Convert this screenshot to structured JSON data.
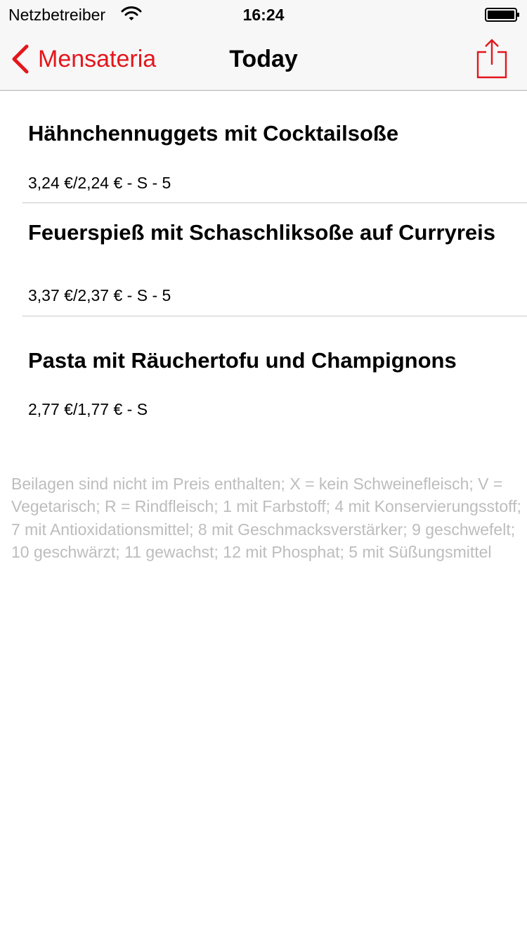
{
  "status_bar": {
    "carrier": "Netzbetreiber",
    "time": "16:24",
    "wifi_icon": "wifi-icon",
    "battery_icon": "battery-full-icon"
  },
  "nav_bar": {
    "back_label": "Mensateria",
    "back_icon": "chevron-left-icon",
    "title": "Today",
    "share_icon": "share-icon",
    "accent_color": "#e4161c"
  },
  "menu_items": [
    {
      "dish": "Hähnchennuggets mit Cocktailsoße",
      "price": "3,24 €/2,24 € - S - 5"
    },
    {
      "dish": "Feuerspieß mit Schaschliksoße  auf Curryreis",
      "price": "3,37 €/2,37 € - S - 5"
    },
    {
      "dish": "Pasta mit Räuchertofu und Champignons",
      "price": "2,77 €/1,77 € - S"
    }
  ],
  "legend": "Beilagen sind nicht im Preis enthalten; X = kein Schweinefleisch; V = Vegetarisch; R = Rindfleisch; 1 mit Farbstoff; 4 mit Konservierungsstoff; 7 mit Antioxidationsmittel; 8 mit Geschmacksverstärker; 9 geschwefelt; 10 geschwärzt; 11 gewachst; 12 mit Phosphat; 5 mit Süßungsmittel",
  "colors": {
    "accent": "#e4161c",
    "bar_background": "#f7f7f7",
    "legend_text": "#bdbdbd",
    "separator": "#c8c7cc"
  }
}
